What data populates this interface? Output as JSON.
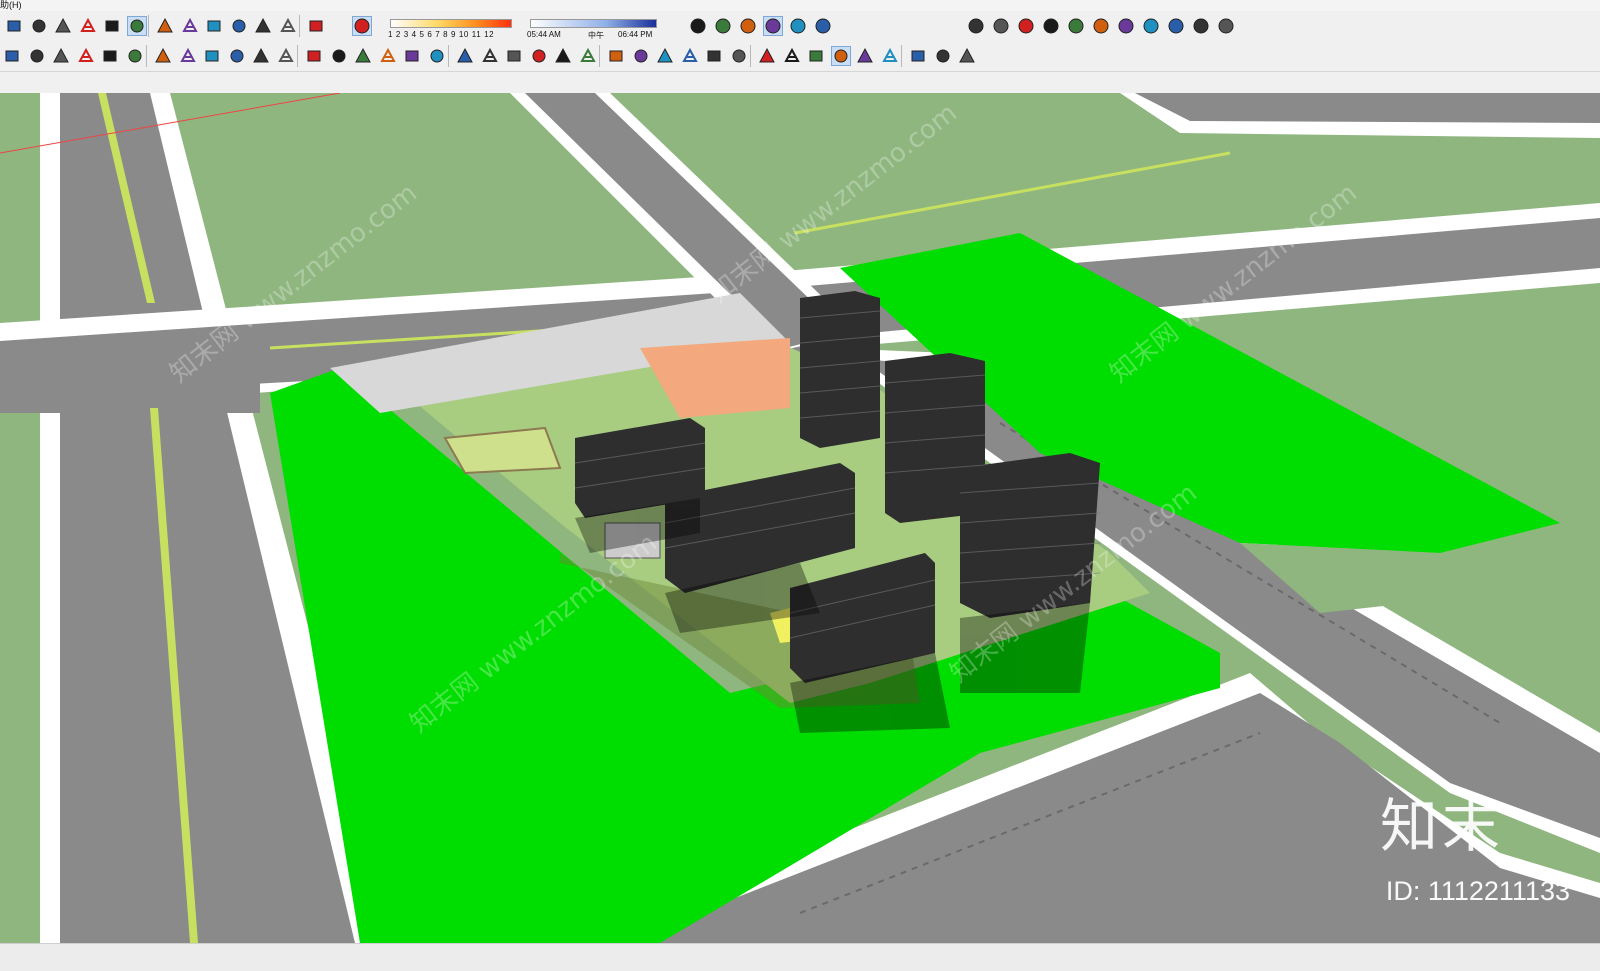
{
  "menubar": {
    "label": "助(H)"
  },
  "shadow": {
    "month_labels": "1 2 3 4 5 6 7 8 9 10 11 12",
    "time_start": "05:44 AM",
    "time_mid": "中午",
    "time_end": "06:44 PM"
  },
  "watermark": {
    "text": "知末网 www.znzmo.com"
  },
  "brand": {
    "logo": "知末",
    "id": "ID: 1112211133"
  },
  "colors": {
    "lawn": "#00dd00",
    "field": "#8fb67f",
    "road": "#8a8a8a",
    "curb": "#ffffff",
    "lane": "#c8e060",
    "building": "#2e2e2e",
    "plaza": "#d8d8d8",
    "orange": "#f3a97d",
    "site": "#a8cc80"
  },
  "toolbar_row1": [
    "box-icon",
    "eraser-icon",
    "rectangle-icon",
    "circle-icon",
    "box-alt-icon",
    "layers-icon",
    "paint-icon",
    "components-icon",
    "section-icon",
    "home-icon",
    "warehouse-icon",
    "house-icon",
    "garage-icon",
    "shadow-toggle-icon",
    "gift-icon",
    "orbit-icon",
    "screen-icon",
    "camera-icon",
    "walk-icon",
    "flower-icon",
    "extension-warehouse-icon",
    "refresh-icon",
    "stack-icon",
    "plus-circle-icon",
    "tree-icon",
    "terrain-icon",
    "checker-icon",
    "cloud-icon",
    "gear-icon",
    "mail-icon",
    "info-icon"
  ],
  "toolbar_row2": [
    "select-icon",
    "scale-icon",
    "red-box-icon",
    "red-stamp-icon",
    "red-paint-icon",
    "heart-icon",
    "user-icon",
    "move-icon",
    "push-icon",
    "stair-icon",
    "railing-icon",
    "ladder-icon",
    "wall-icon",
    "window-icon",
    "pen-icon",
    "curve-icon",
    "line-icon",
    "roof-icon",
    "tile-icon",
    "brush-icon",
    "pipe-icon",
    "arc-icon",
    "cut-icon",
    "box3-icon",
    "tool-a-icon",
    "tool-b-icon",
    "tool-c-icon",
    "tool-d-icon",
    "tool-e-icon",
    "tool-f-icon",
    "tool-g-icon",
    "tool-h-icon",
    "tool-i-icon",
    "tool-j-icon",
    "dot-icon",
    "cone-icon",
    "dash-icon",
    "square-icon",
    "hide-icon"
  ]
}
